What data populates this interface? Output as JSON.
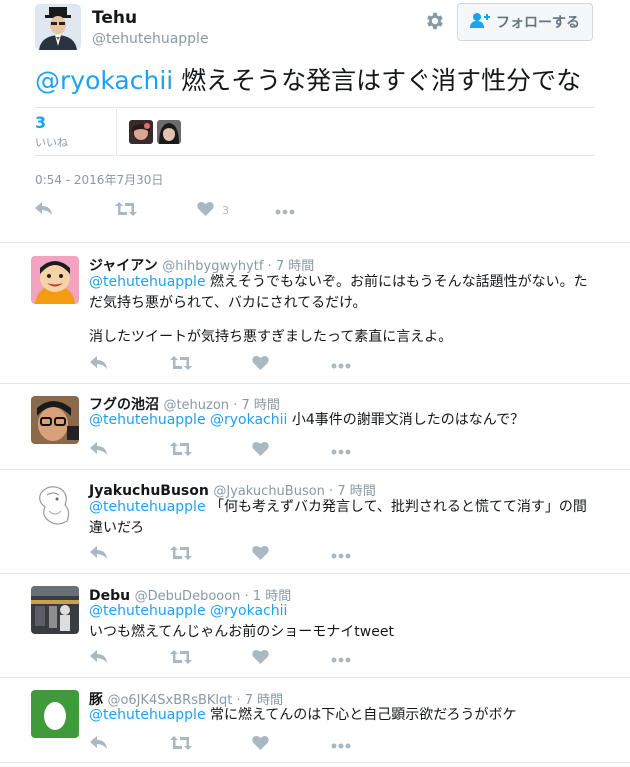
{
  "main_tweet": {
    "name": "Tehu",
    "handle": "@tehutehuapple",
    "follow_label": "フォローする",
    "mention": "@ryokachii",
    "text": " 燃えそうな発言はすぐ消す性分でな",
    "likes_count": "3",
    "likes_label": "いいね",
    "date": "0:54 - 2016年7月30日",
    "action_like_count": "3"
  },
  "replies": [
    {
      "name": "ジャイアン",
      "meta": "@hihbygwyhytf · 7 時間",
      "lines": [
        {
          "mentions": "@tehutehuapple",
          "text": " 燃えそうでもないぞ。お前にはもうそんな話題性がない。ただ気持ち悪がられて、バカにされてるだけ。"
        },
        {
          "mentions": "",
          "text": "消したツイートが気持ち悪すぎましたって素直に言えよ。"
        }
      ]
    },
    {
      "name": "フグの池沼",
      "meta": "@tehuzon · 7 時間",
      "lines": [
        {
          "mentions": "@tehutehuapple @ryokachii",
          "text": " 小4事件の謝罪文消したのはなんで？"
        }
      ]
    },
    {
      "name": "JyakuchuBuson",
      "meta": "@JyakuchuBuson · 7 時間",
      "lines": [
        {
          "mentions": "@tehutehuapple",
          "text": " 「何も考えずバカ発言して、批判されると慌てて消す」の間違いだろ"
        }
      ]
    },
    {
      "name": "Debu",
      "meta": "@DebuDebooon · 1 時間",
      "lines": [
        {
          "mentions": "@tehutehuapple @ryokachii",
          "text": ""
        },
        {
          "mentions": "",
          "text": "いつも燃えてんじゃんお前のショーモナイtweet"
        }
      ]
    },
    {
      "name": "豚",
      "meta": "@o6JK4SxBRsBKlqt · 7 時間",
      "lines": [
        {
          "mentions": "@tehutehuapple",
          "text": " 常に燃えてんのは下心と自己顕示欲だろうがボケ"
        }
      ]
    }
  ],
  "colors": {
    "accent": "#1da1f2",
    "muted": "#8899a6",
    "action_icon": "#aab8c2",
    "divider": "#e1e8ed"
  },
  "icons": [
    "settings-gear-icon",
    "follow-user-plus-icon",
    "reply-icon",
    "retweet-icon",
    "heart-icon",
    "more-dots-icon"
  ]
}
